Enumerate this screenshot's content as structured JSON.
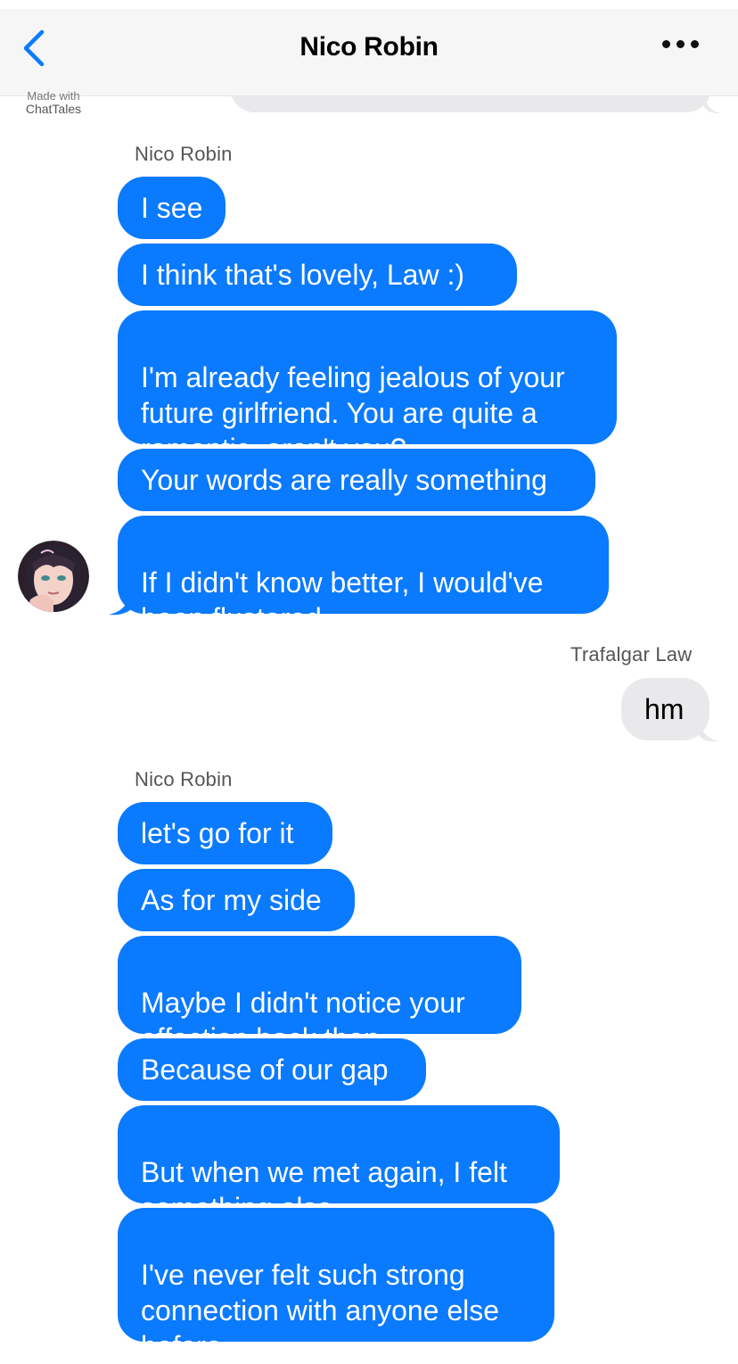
{
  "header": {
    "title": "Nico Robin",
    "back_icon": "chevron-left-icon",
    "more_icon": "ellipsis-icon"
  },
  "watermark": {
    "line1": "Made with",
    "line2": "ChatTales"
  },
  "colors": {
    "incoming_bubble": "#0a7aff",
    "outgoing_bubble": "#e9e9eb",
    "accent": "#0a7aff"
  },
  "thread": {
    "group1": {
      "sender": "Nico Robin",
      "messages": [
        "I see",
        "I think that's lovely, Law :)",
        "I'm already feeling jealous of your\nfuture girlfriend. You are quite a\nromantic, aren't you?",
        "Your words are really something",
        "If I didn't know better, I would've\nbeen flustered"
      ]
    },
    "group2": {
      "sender": "Trafalgar Law",
      "messages": [
        "hm"
      ]
    },
    "group3": {
      "sender": "Nico Robin",
      "messages": [
        "let's go for it",
        "As for my side",
        "Maybe I didn't notice your\naffection back then",
        "Because of our gap",
        "But when we met again, I felt\nsomething else",
        "I've never felt such strong\nconnection with anyone else\nbefore"
      ]
    }
  }
}
